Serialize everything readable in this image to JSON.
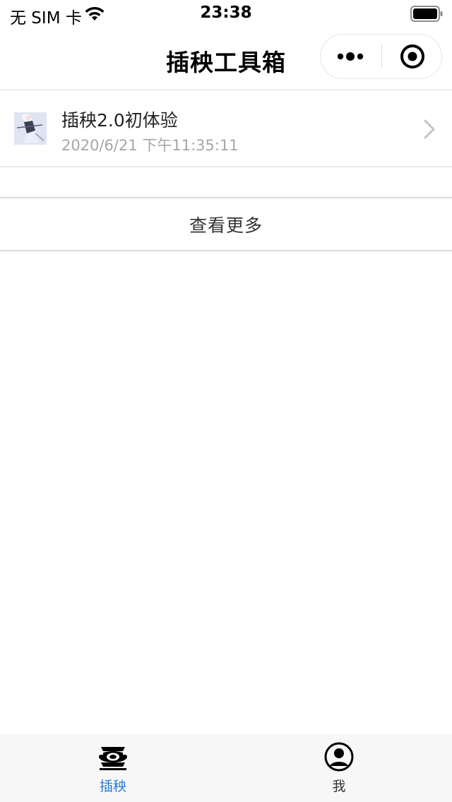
{
  "status_bar": {
    "carrier": "无 SIM 卡",
    "time": "23:38",
    "wifi_icon": "wifi-icon",
    "battery_icon": "battery-full-icon"
  },
  "nav": {
    "title": "插秧工具箱",
    "more_icon": "more-dots-icon",
    "close_icon": "target-close-icon"
  },
  "posts": [
    {
      "title": "插秧2.0初体验",
      "date": "2020/6/21 下午11:35:11",
      "thumbnail": "anime-character-thumbnail"
    }
  ],
  "more_label": "查看更多",
  "tabs": [
    {
      "label": "插秧",
      "icon": "seedling-tray-icon",
      "active": true
    },
    {
      "label": "我",
      "icon": "user-circle-icon",
      "active": false
    }
  ],
  "colors": {
    "accent": "#2b7bd6",
    "divider": "#d6dde2",
    "secondary_text": "#a6a6a6"
  }
}
